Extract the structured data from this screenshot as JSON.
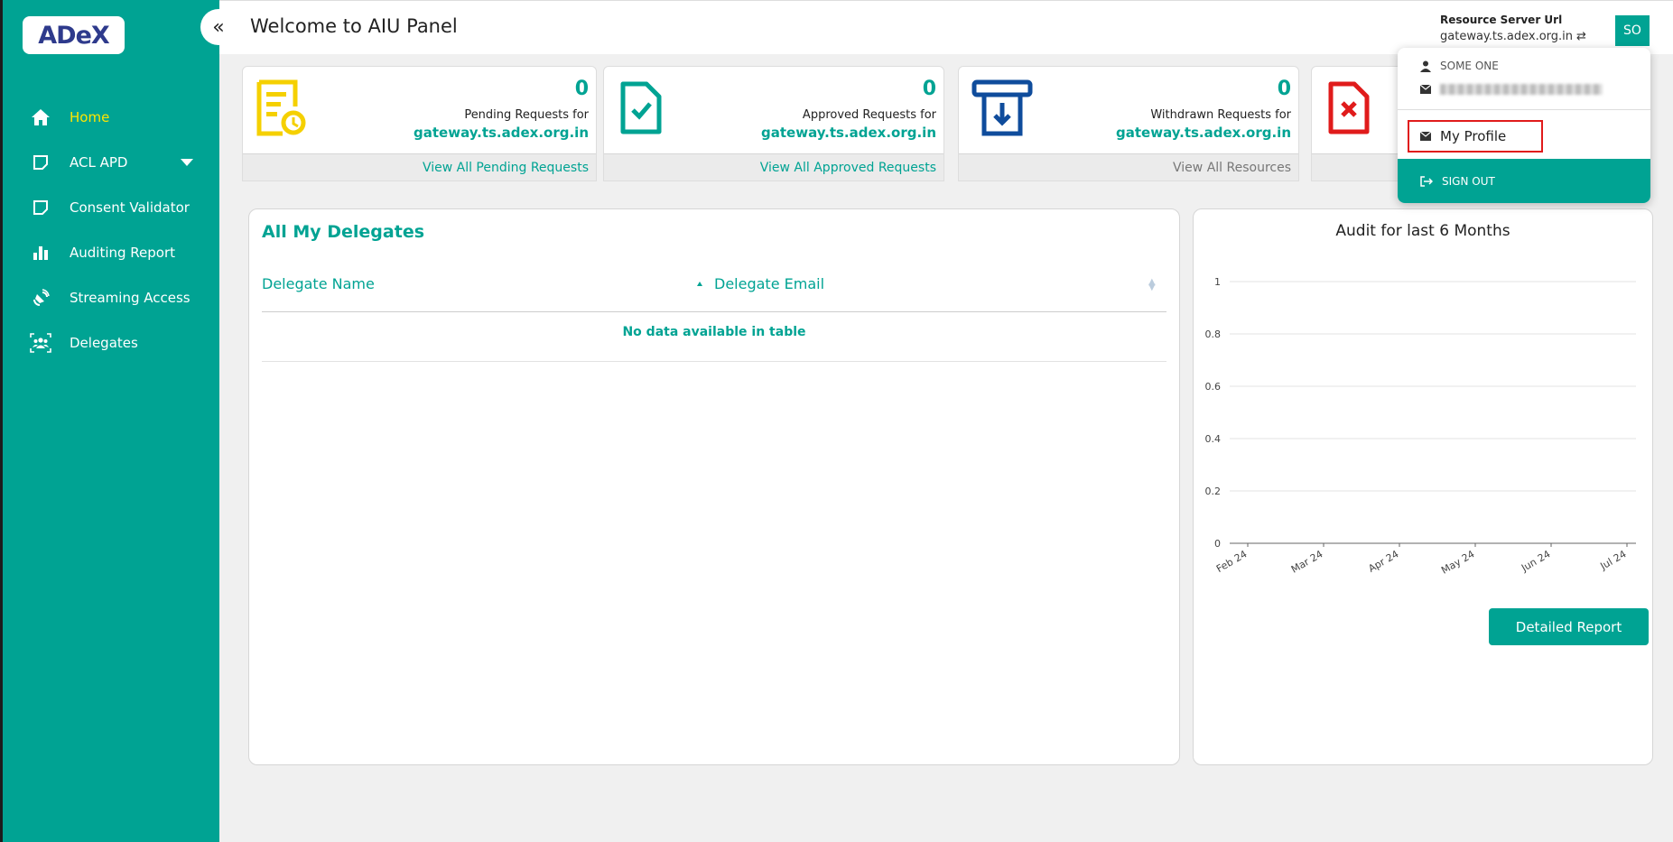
{
  "sidebar": {
    "logo_text": "ADeX",
    "collapse_icon": "«",
    "items": [
      {
        "label": "Home",
        "icon": "home-icon"
      },
      {
        "label": "ACL APD",
        "icon": "note-icon"
      },
      {
        "label": "Consent Validator",
        "icon": "note-icon"
      },
      {
        "label": "Auditing Report",
        "icon": "bar-chart-icon"
      },
      {
        "label": "Streaming Access",
        "icon": "satellite-icon"
      },
      {
        "label": "Delegates",
        "icon": "group-icon"
      }
    ]
  },
  "header": {
    "title": "Welcome to AIU Panel",
    "resource_server_label": "Resource Server Url",
    "resource_server_value": "gateway.ts.adex.org.in",
    "refresh_glyph": "⇄",
    "avatar_initials": "SO"
  },
  "cards": [
    {
      "count": "0",
      "desc": "Pending Requests for",
      "host": "gateway.ts.adex.org.in",
      "link": "View All Pending Requests",
      "icon_color": "#f5d000"
    },
    {
      "count": "0",
      "desc": "Approved Requests for",
      "host": "gateway.ts.adex.org.in",
      "link": "View All Approved Requests",
      "icon_color": "#00a393"
    },
    {
      "count": "0",
      "desc": "Withdrawn Requests for",
      "host": "gateway.ts.adex.org.in",
      "link": "View All Resources",
      "icon_color": "#0f4c9c"
    },
    {
      "icon_color": "#e01b1b"
    }
  ],
  "delegates": {
    "title": "All My Delegates",
    "col_name": "Delegate Name",
    "col_email": "Delegate Email",
    "empty_text": "No data available in table"
  },
  "audit": {
    "title": "Audit for last 6 Months",
    "button": "Detailed Report"
  },
  "chart_data": {
    "type": "line",
    "title": "Audit for last 6 Months",
    "categories": [
      "Feb 24",
      "Mar 24",
      "Apr 24",
      "May 24",
      "Jun 24",
      "Jul 24"
    ],
    "yticks": [
      "0",
      "0.2",
      "0.4",
      "0.6",
      "0.8",
      "1"
    ],
    "ylim": [
      0,
      1
    ],
    "series": [
      {
        "values": [
          0,
          0,
          0,
          0,
          0,
          0
        ]
      }
    ],
    "grid": true
  },
  "dropdown": {
    "user_name": "SOME ONE",
    "profile_label": "My Profile",
    "signout_label": "SIGN OUT"
  },
  "colors": {
    "primary": "#00a393",
    "active_nav": "#ffe600",
    "highlight_border": "#e01b1b"
  }
}
